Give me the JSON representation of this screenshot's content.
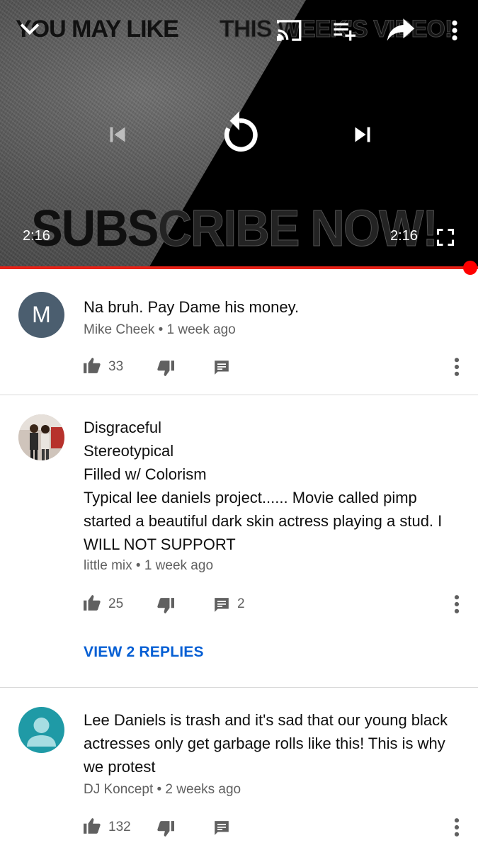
{
  "player": {
    "banner_left": "YOU MAY LIKE",
    "banner_right": "THIS WEEK'S VIDEO!",
    "subscribe_banner_a": "SUBS",
    "subscribe_banner_b": "CRIBE NOW!",
    "current_time": "2:16",
    "duration": "2:16",
    "progress": 1.0,
    "accent_color": "#ff0000",
    "icons": [
      "chevron-down-icon",
      "cast-icon",
      "add-to-queue-icon",
      "share-icon",
      "more-vert-icon",
      "skip-previous-icon",
      "replay-icon",
      "skip-next-icon",
      "fullscreen-icon"
    ]
  },
  "comments": [
    {
      "avatar_letter": "M",
      "lines": [
        "Na bruh. Pay Dame his money."
      ],
      "meta": "Mike Cheek • 1 week ago",
      "likes": "33",
      "replies_count": "",
      "view_replies": ""
    },
    {
      "avatar_letter": "",
      "lines": [
        "Disgraceful",
        "Stereotypical",
        "Filled w/ Colorism",
        "Typical lee daniels project...... Movie called pimp",
        "started a beautiful dark skin actress playing a stud. I",
        "WILL NOT SUPPORT"
      ],
      "meta": "little mix • 1 week ago",
      "likes": "25",
      "replies_count": "2",
      "view_replies": "VIEW 2 REPLIES"
    },
    {
      "avatar_letter": "",
      "lines": [
        "Lee Daniels is trash and it's sad that our young black",
        "actresses only get garbage rolls like this! This is why",
        "we protest"
      ],
      "meta": "DJ Koncept • 2 weeks ago",
      "likes": "132",
      "replies_count": "",
      "view_replies": ""
    }
  ]
}
